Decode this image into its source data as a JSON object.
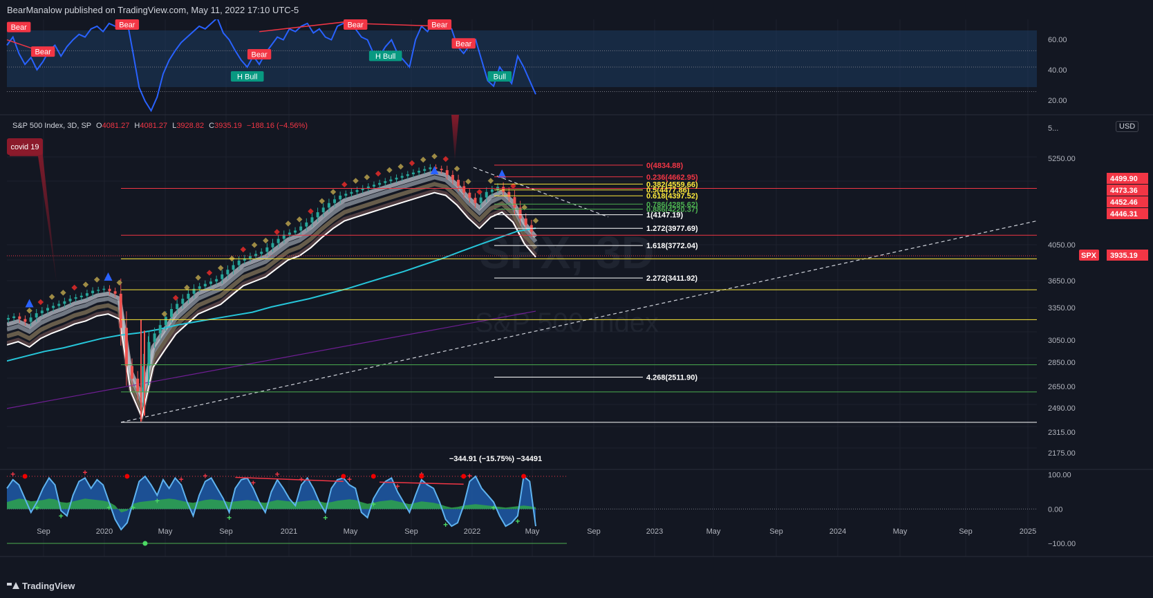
{
  "header": {
    "attribution": "BearManalow published on TradingView.com, May 11, 2022 17:10 UTC-5"
  },
  "footer": {
    "brand": "TradingView"
  },
  "legend": {
    "symbol": "S&P 500 Index, 3D, SP",
    "open_label": "O",
    "open": "4081.27",
    "high_label": "H",
    "high": "4081.27",
    "low_label": "L",
    "low": "3928.82",
    "close_label": "C",
    "close": "3935.19",
    "change": "−188.16 (−4.56%)"
  },
  "currency": "USD",
  "watermark": {
    "ticker": "SPX, 3D",
    "name": "S&P 500 Index"
  },
  "chart_data": [
    {
      "type": "line",
      "panel": "oscillator-top",
      "axis_ticks": [
        "60.00",
        "40.00",
        "20.00"
      ],
      "ylim": [
        15,
        85
      ],
      "levels": [
        62,
        50,
        32
      ],
      "series_x": [
        0,
        1,
        2,
        3,
        4,
        5,
        6,
        7,
        8,
        9,
        10,
        11,
        12,
        13,
        14,
        15,
        16,
        17,
        18,
        19,
        20,
        21,
        22,
        23,
        24,
        25,
        26,
        27,
        28,
        29,
        30,
        31,
        32,
        33,
        34,
        35,
        36,
        37,
        38,
        39,
        40,
        41,
        42,
        43,
        44,
        45,
        46,
        47,
        48,
        49,
        50,
        51,
        52,
        53,
        54,
        55,
        56,
        57,
        58,
        59,
        60,
        61,
        62,
        63,
        64,
        65,
        66,
        67,
        68,
        69,
        70,
        71,
        72,
        73,
        74,
        75,
        76,
        77,
        78,
        79,
        80,
        81,
        82,
        83,
        84,
        85,
        86,
        87,
        88
      ],
      "series_y": [
        66,
        72,
        60,
        52,
        57,
        48,
        54,
        62,
        66,
        58,
        65,
        70,
        74,
        72,
        78,
        80,
        76,
        82,
        80,
        78,
        84,
        60,
        35,
        25,
        18,
        28,
        45,
        55,
        62,
        68,
        72,
        76,
        80,
        78,
        82,
        86,
        75,
        70,
        62,
        55,
        50,
        58,
        52,
        60,
        66,
        72,
        70,
        78,
        76,
        80,
        82,
        75,
        78,
        72,
        70,
        80,
        82,
        84,
        78,
        72,
        70,
        60,
        58,
        65,
        70,
        60,
        55,
        50,
        70,
        80,
        76,
        84,
        82,
        80,
        78,
        65,
        60,
        66,
        70,
        55,
        40,
        36,
        50,
        44,
        38,
        58,
        50,
        40,
        30
      ],
      "signals": [
        {
          "label": "Bear",
          "x": 1
        },
        {
          "label": "Bear",
          "x": 6
        },
        {
          "label": "Bear",
          "x": 20
        },
        {
          "label": "H Bull",
          "x": 40
        },
        {
          "label": "Bear",
          "x": 42
        },
        {
          "label": "Bear",
          "x": 58
        },
        {
          "label": "H Bull",
          "x": 63
        },
        {
          "label": "Bear",
          "x": 72
        },
        {
          "label": "Bear",
          "x": 76
        },
        {
          "label": "Bull",
          "x": 82
        }
      ]
    },
    {
      "type": "line",
      "panel": "price",
      "log_scale": true,
      "ylim": [
        2120,
        5600
      ],
      "axis_ticks": [
        "5...",
        "5250.00",
        "4050.00",
        "3650.00",
        "3350.00",
        "3050.00",
        "2850.00",
        "2650.00",
        "2490.00",
        "2315.00",
        "2175.00"
      ],
      "price_labels": [
        {
          "value": "4499.90",
          "color": "#f23645"
        },
        {
          "value": "4473.36",
          "color": "#f23645"
        },
        {
          "value": "4452.46",
          "color": "#f23645"
        },
        {
          "value": "4446.31",
          "color": "#f23645"
        },
        {
          "value": "3935.19",
          "color": "#f23645",
          "tag": "SPX"
        }
      ],
      "x_ticks": [
        "Sep",
        "2020",
        "May",
        "Sep",
        "2021",
        "May",
        "Sep",
        "2022",
        "May",
        "Sep",
        "2023",
        "May",
        "Sep",
        "2024",
        "May",
        "Sep",
        "2025"
      ],
      "close": [
        3000,
        3030,
        2980,
        3060,
        3110,
        3150,
        3200,
        3230,
        3280,
        3300,
        3250,
        2600,
        2400,
        2800,
        2950,
        3100,
        3200,
        3300,
        3350,
        3400,
        3500,
        3600,
        3650,
        3700,
        3800,
        3900,
        3950,
        4050,
        4180,
        4300,
        4400,
        4450,
        4500,
        4550,
        4600,
        4650,
        4700,
        4750,
        4800,
        4760,
        4620,
        4440,
        4300,
        4450,
        4520,
        4380,
        4100,
        3935
      ],
      "fib_levels": [
        {
          "label": "0(4834.88)",
          "color": "#f23645"
        },
        {
          "label": "0.236(4662.95)",
          "color": "#f23645"
        },
        {
          "label": "0.382(4559.66)",
          "color": "#ffeb3b"
        },
        {
          "label": "0.5(4477.86)",
          "color": "#ffeb3b"
        },
        {
          "label": "0.618(4397.52)",
          "color": "#ffeb3b"
        },
        {
          "label": "0.786(4285.62)",
          "color": "#4caf50"
        },
        {
          "label": "0.886(4220.37)",
          "color": "#4caf50"
        },
        {
          "label": "1(4147.19)",
          "color": "#ffffff"
        },
        {
          "label": "1.272(3977.69)",
          "color": "#ffffff"
        },
        {
          "label": "1.618(3772.04)",
          "color": "#ffffff"
        },
        {
          "label": "2.272(3411.92)",
          "color": "#ffffff"
        },
        {
          "label": "4.268(2511.90)",
          "color": "#ffffff"
        }
      ],
      "annotation_covid": "covid 19",
      "measure_label": "−344.91 (−15.75%) −34491"
    },
    {
      "type": "area",
      "panel": "oscillator-bottom",
      "ylim": [
        -120,
        115
      ],
      "axis_ticks": [
        "100.00",
        "0.00",
        "−100.00"
      ],
      "series_x": [
        0,
        1,
        2,
        3,
        4,
        5,
        6,
        7,
        8,
        9,
        10,
        11,
        12,
        13,
        14,
        15,
        16,
        17,
        18,
        19,
        20,
        21,
        22,
        23,
        24,
        25,
        26,
        27,
        28,
        29,
        30,
        31,
        32,
        33,
        34,
        35,
        36,
        37,
        38,
        39,
        40,
        41,
        42,
        43,
        44,
        45,
        46,
        47,
        48,
        49,
        50,
        51,
        52,
        53,
        54,
        55,
        56,
        57,
        58,
        59,
        60,
        61,
        62,
        63,
        64,
        65,
        66,
        67,
        68,
        69,
        70,
        71,
        72,
        73,
        74,
        75,
        76,
        77,
        78,
        79,
        80,
        81,
        82,
        83,
        84,
        85,
        86,
        87,
        88
      ],
      "wave": [
        60,
        85,
        70,
        30,
        -10,
        20,
        60,
        90,
        70,
        -5,
        -20,
        40,
        80,
        90,
        60,
        85,
        70,
        20,
        -30,
        -60,
        -40,
        20,
        80,
        95,
        70,
        40,
        85,
        60,
        90,
        70,
        20,
        -20,
        40,
        80,
        90,
        60,
        30,
        -10,
        60,
        85,
        90,
        60,
        20,
        -10,
        50,
        85,
        60,
        30,
        10,
        70,
        90,
        60,
        20,
        -10,
        60,
        85,
        90,
        70,
        60,
        -10,
        -25,
        30,
        60,
        80,
        90,
        50,
        20,
        -10,
        40,
        85,
        70,
        60,
        20,
        -30,
        -50,
        -40,
        10,
        80,
        95,
        60,
        40,
        20,
        -20,
        -50,
        -40,
        -20,
        95,
        80,
        -50
      ],
      "momentum": [
        20,
        25,
        30,
        28,
        22,
        24,
        26,
        30,
        28,
        20,
        18,
        22,
        26,
        30,
        28,
        26,
        24,
        20,
        10,
        -10,
        -5,
        15,
        20,
        22,
        24,
        26,
        28,
        30,
        28,
        24,
        20,
        18,
        22,
        26,
        28,
        26,
        24,
        20,
        22,
        24,
        26,
        24,
        20,
        18,
        22,
        26,
        24,
        22,
        20,
        22,
        24,
        26,
        22,
        18,
        20,
        24,
        26,
        28,
        26,
        20,
        15,
        18,
        22,
        24,
        26,
        22,
        18,
        14,
        18,
        22,
        20,
        18,
        14,
        8,
        4,
        6,
        10,
        12,
        14,
        12,
        10,
        8,
        6,
        4,
        6,
        8,
        10,
        8,
        5
      ]
    }
  ]
}
